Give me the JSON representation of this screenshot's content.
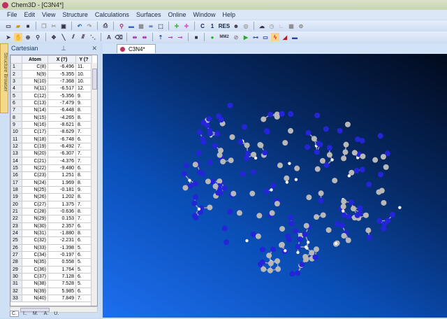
{
  "window": {
    "title": "Chem3D - [C3N4*]"
  },
  "menu": [
    "File",
    "Edit",
    "View",
    "Structure",
    "Calculations",
    "Surfaces",
    "Online",
    "Window",
    "Help"
  ],
  "toolbar_text": {
    "c": "C",
    "one": "1",
    "res": "RES",
    "text_tool": "A",
    "mm2": "MM2"
  },
  "panel": {
    "title": "Cartesian",
    "side_tab": "Structure Browser",
    "columns": [
      "Atom",
      "X (?)",
      "Y (?"
    ],
    "rows": [
      [
        "1",
        "C(8)",
        "-6.496",
        "11."
      ],
      [
        "2",
        "N(9)",
        "-5.355",
        "10."
      ],
      [
        "3",
        "N(10)",
        "-7.368",
        "10."
      ],
      [
        "4",
        "N(11)",
        "-6.517",
        "12."
      ],
      [
        "5",
        "C(12)",
        "-5.356",
        "9."
      ],
      [
        "6",
        "C(13)",
        "-7.479",
        "9."
      ],
      [
        "7",
        "N(14)",
        "-6.448",
        "8."
      ],
      [
        "8",
        "N(15)",
        "-4.265",
        "8."
      ],
      [
        "9",
        "N(16)",
        "-8.621",
        "8."
      ],
      [
        "10",
        "C(17)",
        "-8.629",
        "7."
      ],
      [
        "11",
        "N(18)",
        "-6.748",
        "6."
      ],
      [
        "12",
        "C(19)",
        "-6.492",
        "7."
      ],
      [
        "13",
        "N(20)",
        "-6.307",
        "7."
      ],
      [
        "14",
        "C(21)",
        "-4.376",
        "7."
      ],
      [
        "15",
        "N(22)",
        "-9.480",
        "6."
      ],
      [
        "16",
        "C(23)",
        "1.251",
        "8."
      ],
      [
        "17",
        "N(24)",
        "1.969",
        "8."
      ],
      [
        "18",
        "N(25)",
        "-0.181",
        "9."
      ],
      [
        "19",
        "N(26)",
        "1.202",
        "8."
      ],
      [
        "20",
        "C(27)",
        "1.375",
        "7."
      ],
      [
        "21",
        "C(28)",
        "-0.636",
        "8."
      ],
      [
        "22",
        "N(29)",
        "0.153",
        "7."
      ],
      [
        "23",
        "N(30)",
        "2.357",
        "6."
      ],
      [
        "24",
        "N(31)",
        "-1.880",
        "8."
      ],
      [
        "25",
        "C(32)",
        "-2.231",
        "6."
      ],
      [
        "26",
        "N(33)",
        "-1.398",
        "5."
      ],
      [
        "27",
        "C(34)",
        "-0.197",
        "6."
      ],
      [
        "28",
        "N(35)",
        "0.558",
        "5."
      ],
      [
        "29",
        "C(36)",
        "1.764",
        "5."
      ],
      [
        "30",
        "C(37)",
        "7.128",
        "6."
      ],
      [
        "31",
        "N(38)",
        "7.528",
        "5."
      ],
      [
        "32",
        "N(39)",
        "5.985",
        "6."
      ],
      [
        "33",
        "N(40)",
        "7.849",
        "7."
      ]
    ],
    "bottom_tabs": [
      "C.",
      "I..",
      "M.",
      "A.",
      "U."
    ]
  },
  "document": {
    "tab": "C3N4*"
  },
  "colors": {
    "carbon": "#b8b8b8",
    "nitrogen": "#2424d8",
    "hydrogen": "#f2f2f2",
    "bond": "#9aa0b8"
  }
}
